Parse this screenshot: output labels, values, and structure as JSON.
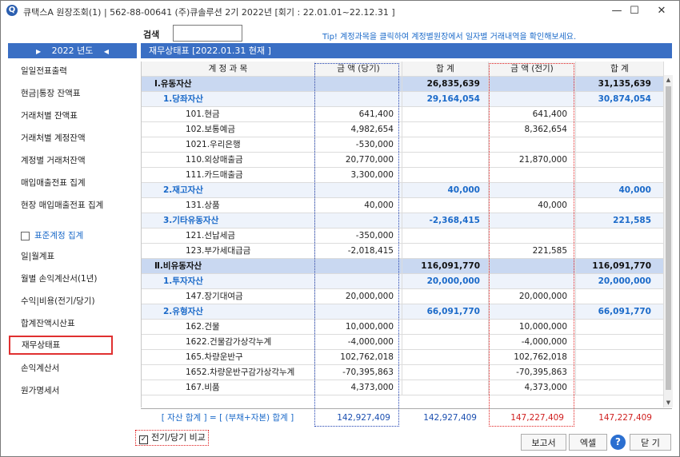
{
  "window": {
    "title": "큐택스A 원장조회(1) | 562-88-00641 (주)큐솔루션 2기 2022년 [회기 : 22.01.01~22.12.31 ]",
    "app_icon": "Q",
    "controls": {
      "minimize": "—",
      "maximize": "☐",
      "close": "✕"
    }
  },
  "search": {
    "label": "검색",
    "value": ""
  },
  "tip": "Tip! 계정과목을 클릭하여 계정별원장에서 일자별 거래내역을 확인해보세요.",
  "year_nav": {
    "prev": "▶",
    "label": "2022 년도",
    "next": "◀"
  },
  "sidebar": {
    "items": [
      {
        "label": "일일전표출력"
      },
      {
        "label": "현금|통장 잔액표"
      },
      {
        "label": "거래처별 잔액표"
      },
      {
        "label": "거래처별 계정잔액"
      },
      {
        "label": "계정별 거래처잔액"
      },
      {
        "label": "매입매출전표 집계"
      },
      {
        "label": "현장 매입매출전표 집계"
      }
    ],
    "standard_account": {
      "label": "표준계정 집계",
      "checked": false
    },
    "items2": [
      {
        "label": "일|월계표"
      },
      {
        "label": "월별 손익계산서(1년)"
      },
      {
        "label": "수익|비용(전기/당기)"
      },
      {
        "label": "합계잔액시산표"
      },
      {
        "label": "재무상태표",
        "selected": true
      },
      {
        "label": "손익계산서"
      },
      {
        "label": "원가명세서"
      }
    ]
  },
  "report": {
    "header": "재무상태표  [2022.01.31 현재 ]",
    "columns": [
      "계 정 과 목",
      "금  액 (당기)",
      "합    계",
      "금  액 (전기)",
      "합    계"
    ],
    "rows": [
      {
        "level": 1,
        "name": "Ⅰ.유동자산",
        "cur": "",
        "cur_sum": "26,835,639",
        "prev": "",
        "prev_sum": "31,135,639"
      },
      {
        "level": 2,
        "name": "1.당좌자산",
        "cur": "",
        "cur_sum": "29,164,054",
        "prev": "",
        "prev_sum": "30,874,054"
      },
      {
        "level": 3,
        "name": "101.현금",
        "cur": "641,400",
        "cur_sum": "",
        "prev": "641,400",
        "prev_sum": ""
      },
      {
        "level": 3,
        "name": "102.보통예금",
        "cur": "4,982,654",
        "cur_sum": "",
        "prev": "8,362,654",
        "prev_sum": ""
      },
      {
        "level": 3,
        "name": "1021.우리은행",
        "cur": "-530,000",
        "cur_sum": "",
        "prev": "",
        "prev_sum": ""
      },
      {
        "level": 3,
        "name": "110.외상매출금",
        "cur": "20,770,000",
        "cur_sum": "",
        "prev": "21,870,000",
        "prev_sum": ""
      },
      {
        "level": 3,
        "name": "111.카드매출금",
        "cur": "3,300,000",
        "cur_sum": "",
        "prev": "",
        "prev_sum": ""
      },
      {
        "level": 2,
        "name": "2.재고자산",
        "cur": "",
        "cur_sum": "40,000",
        "prev": "",
        "prev_sum": "40,000"
      },
      {
        "level": 3,
        "name": "131.상품",
        "cur": "40,000",
        "cur_sum": "",
        "prev": "40,000",
        "prev_sum": ""
      },
      {
        "level": 2,
        "name": "3.기타유동자산",
        "cur": "",
        "cur_sum": "-2,368,415",
        "prev": "",
        "prev_sum": "221,585"
      },
      {
        "level": 3,
        "name": "121.선납세금",
        "cur": "-350,000",
        "cur_sum": "",
        "prev": "",
        "prev_sum": ""
      },
      {
        "level": 3,
        "name": "123.부가세대급금",
        "cur": "-2,018,415",
        "cur_sum": "",
        "prev": "221,585",
        "prev_sum": ""
      },
      {
        "level": 1,
        "name": "Ⅱ.비유동자산",
        "cur": "",
        "cur_sum": "116,091,770",
        "prev": "",
        "prev_sum": "116,091,770"
      },
      {
        "level": 2,
        "name": "1.투자자산",
        "cur": "",
        "cur_sum": "20,000,000",
        "prev": "",
        "prev_sum": "20,000,000"
      },
      {
        "level": 3,
        "name": "147.장기대여금",
        "cur": "20,000,000",
        "cur_sum": "",
        "prev": "20,000,000",
        "prev_sum": ""
      },
      {
        "level": 2,
        "name": "2.유형자산",
        "cur": "",
        "cur_sum": "66,091,770",
        "prev": "",
        "prev_sum": "66,091,770"
      },
      {
        "level": 3,
        "name": "162.건물",
        "cur": "10,000,000",
        "cur_sum": "",
        "prev": "10,000,000",
        "prev_sum": ""
      },
      {
        "level": 3,
        "name": "1622.건물감가상각누계",
        "cur": "-4,000,000",
        "cur_sum": "",
        "prev": "-4,000,000",
        "prev_sum": ""
      },
      {
        "level": 3,
        "name": "165.차량운반구",
        "cur": "102,762,018",
        "cur_sum": "",
        "prev": "102,762,018",
        "prev_sum": ""
      },
      {
        "level": 3,
        "name": "1652.차량운반구감가상각누계",
        "cur": "-70,395,863",
        "cur_sum": "",
        "prev": "-70,395,863",
        "prev_sum": ""
      },
      {
        "level": 3,
        "name": "167.비품",
        "cur": "4,373,000",
        "cur_sum": "",
        "prev": "4,373,000",
        "prev_sum": ""
      }
    ],
    "total": {
      "label": "[ 자산 합계 ]  =  [ (부채+자본) 합계 ]",
      "cur": "142,927,409",
      "cur_sum": "142,927,409",
      "prev": "147,227,409",
      "prev_sum": "147,227,409"
    },
    "colors": {
      "header_blue": "#3a6fc4",
      "group_blue": "#1b6ac9",
      "highlight_red": "#e03030",
      "prev_red": "#d02020",
      "cur_blue": "#1b4fb0"
    }
  },
  "compare": {
    "label": "전기/당기 비교",
    "checked": true,
    "mark": "✓"
  },
  "buttons": {
    "report": "보고서",
    "excel": "엑셀",
    "help": "?",
    "close": "닫 기"
  }
}
